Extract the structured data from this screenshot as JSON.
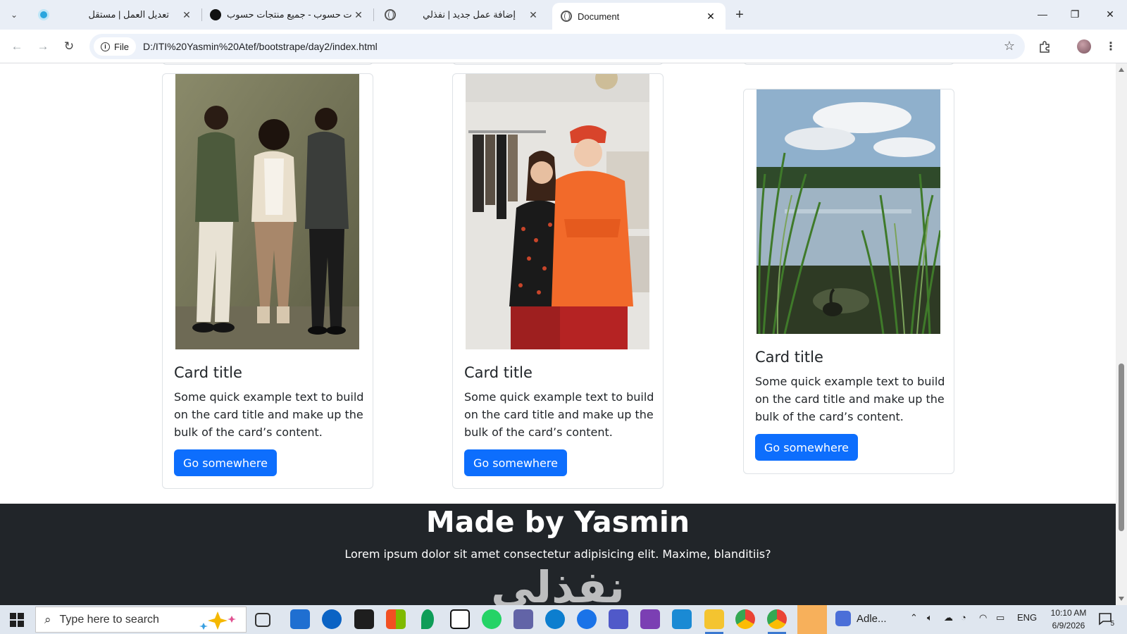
{
  "browser": {
    "tabs": [
      {
        "title": "تعديل العمل | مستقل",
        "active": false
      },
      {
        "title": "حسابات حسوب - جميع منتجات حسوب",
        "active": false
      },
      {
        "title": "إضافة عمل جديد | نفذلي",
        "active": false
      },
      {
        "title": "Document",
        "active": true
      }
    ],
    "site_info_label": "File",
    "url": "D:/ITI%20Yasmin%20Atef/bootstrape/day2/index.html"
  },
  "cards": [
    {
      "title": "Card title",
      "text": "Some quick example text to build on the card title and make up the bulk of the card’s content.",
      "button": "Go somewhere"
    },
    {
      "title": "Card title",
      "text": "Some quick example text to build on the card title and make up the bulk of the card’s content.",
      "button": "Go somewhere"
    },
    {
      "title": "Card title",
      "text": "Some quick example text to build on the card title and make up the bulk of the card’s content.",
      "button": "Go somewhere"
    }
  ],
  "footer": {
    "heading": "Made by Yasmin",
    "text": "Lorem ipsum dolor sit amet consectetur adipisicing elit. Maxime, blanditiis?",
    "watermark": "نفذلي"
  },
  "taskbar": {
    "search_placeholder": "Type here to search",
    "running_app_label": "Adle...",
    "language": "ENG",
    "time": "10:10 AM",
    "date": "6/9/2026",
    "notification_count": "5"
  },
  "colors": {
    "primary_button": "#0d6efd",
    "footer_bg": "#212529"
  }
}
